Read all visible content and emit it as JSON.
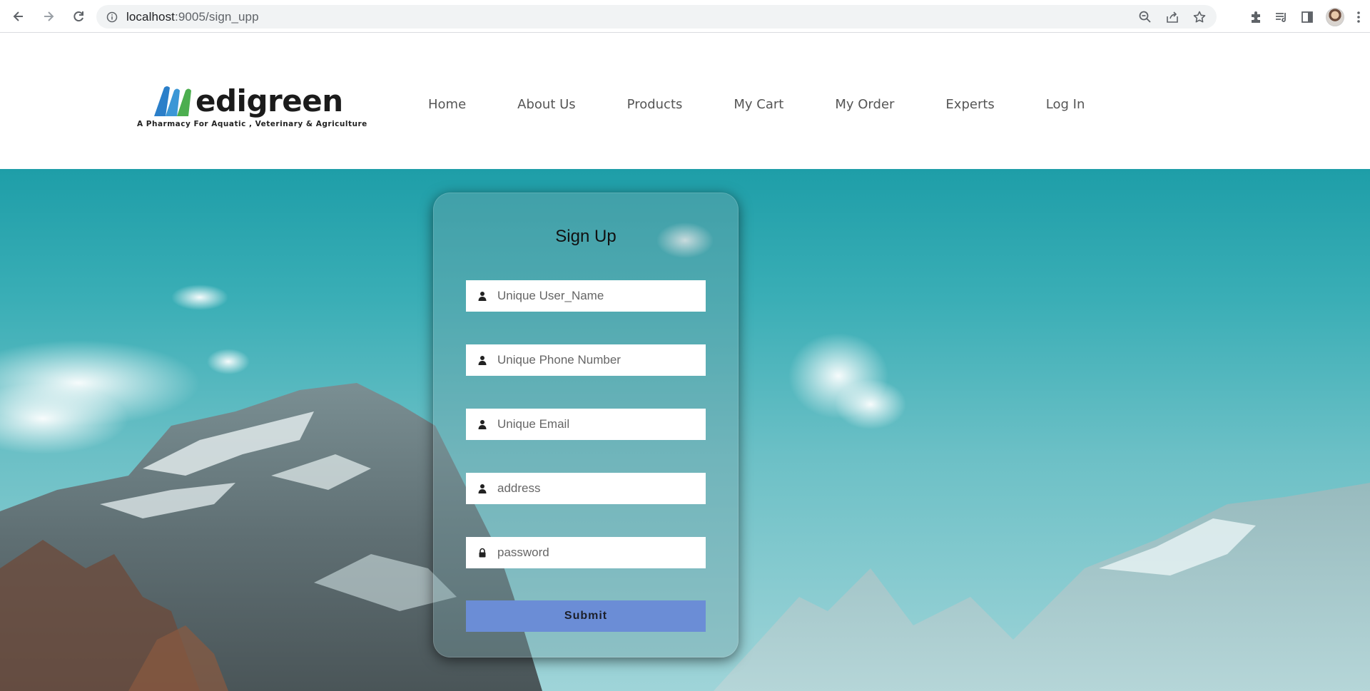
{
  "browser": {
    "url_host": "localhost",
    "url_rest": ":9005/sign_upp"
  },
  "brand": {
    "name": "edigreen",
    "tagline": "A Pharmacy For Aquatic , Veterinary & Agriculture",
    "colors": {
      "blue": "#2b7fc9",
      "green": "#4cae4f",
      "text": "#1b1b1b"
    }
  },
  "nav": {
    "items": [
      {
        "label": "Home"
      },
      {
        "label": "About Us"
      },
      {
        "label": "Products"
      },
      {
        "label": "My Cart"
      },
      {
        "label": "My Order"
      },
      {
        "label": "Experts"
      },
      {
        "label": "Log In"
      }
    ]
  },
  "signup": {
    "title": "Sign Up",
    "fields": [
      {
        "placeholder": "Unique User_Name",
        "icon": "user-icon"
      },
      {
        "placeholder": "Unique Phone Number",
        "icon": "user-icon"
      },
      {
        "placeholder": "Unique Email",
        "icon": "user-icon"
      },
      {
        "placeholder": "address",
        "icon": "user-icon"
      },
      {
        "placeholder": "password",
        "icon": "lock-icon"
      }
    ],
    "submit_label": "Submit",
    "submit_color": "#6b8dd6"
  }
}
